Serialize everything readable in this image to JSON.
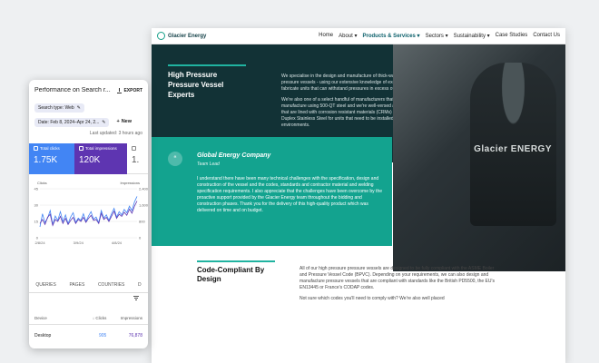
{
  "website": {
    "brand": "Glacier Energy",
    "nav": [
      {
        "label": "Home"
      },
      {
        "label": "About ▾"
      },
      {
        "label": "Products & Services ▾",
        "active": true
      },
      {
        "label": "Sectors ▾"
      },
      {
        "label": "Sustainability ▾"
      },
      {
        "label": "Case Studies"
      },
      {
        "label": "Contact Us"
      }
    ],
    "hero_title": "High Pressure Pressure Vessel Experts",
    "hero_p1": "We specialise in the design and manufacture of thick-walled high pressure pressure vessels - using our extensive knowledge of exotic materials to fabricate units that can withstand pressures in excess of 460 barg.",
    "hero_p2": "We're also one of a select handful of manufacturers that know how to manufacture using 500-QT steel and we're well-versed at building vessels that are lined with corrosion resistant materials (CRMs) like Austenitic or Duplex Stainless Steel for units that need to be installed in inhospitable environments.",
    "photo_brand": "Glacier ENERGY",
    "testimonial": {
      "name": "Global Energy Company",
      "role": "Team Lead",
      "text": "I understand there have been many technical challenges with the specification, design and construction of the vessel and the codes, standards and contractor material and welding specification requirements. I also appreciate that the challenges have been overcome by the proactive support provided by the Glacier Energy team throughout the bidding and construction phases. Thank you for the delivery of this high-quality product which was delivered on time and on budget."
    },
    "code_title": "Code-Compliant By Design",
    "code_p1": "All of our high pressure pressure vessels are designed to be fully compliant with the ASME Boiler and Pressure Vessel Code (BPVC). Depending on your requirements, we can also design and manufacture pressure vessels that are compliant with standards like the British PD5500, the EU's EN13445 or France's CODAP codes.",
    "code_p2": "Not sure which codes you'll need to comply with? We're also well placed"
  },
  "gsc": {
    "title": "Performance on Search r...",
    "export": "EXPORT",
    "search_type": "Search type: Web",
    "date_range": "Date: Feb 8, 2024–Apr 24, 2...",
    "new": "New",
    "updated": "Last updated: 3 hours ago",
    "metrics": {
      "clicks_label": "Total clicks",
      "clicks_value": "1.75K",
      "impr_label": "Total impressions",
      "impr_value": "120K",
      "third_label": "",
      "third_value": "1."
    },
    "tabs": [
      "QUERIES",
      "PAGES",
      "COUNTRIES",
      "D"
    ],
    "table": {
      "headers": [
        "Device",
        "Clicks",
        "Impressions"
      ],
      "rows": [
        {
          "device": "Desktop",
          "clicks": "905",
          "impressions": "76,878"
        }
      ]
    }
  },
  "chart_data": {
    "type": "line",
    "title": "",
    "xlabel": "",
    "ylabel": "Clicks",
    "y2label": "Impressions",
    "x": [
      "2/8/24",
      "2/10",
      "2/12",
      "2/14",
      "2/16",
      "2/18",
      "2/20",
      "2/22",
      "2/24",
      "2/26",
      "2/28",
      "3/1",
      "3/3",
      "3/5",
      "3/7",
      "3/9",
      "3/11",
      "3/13",
      "3/15",
      "3/17",
      "3/19",
      "3/21",
      "3/23",
      "3/25",
      "3/27",
      "3/29",
      "3/31",
      "4/2",
      "4/4",
      "4/6",
      "4/8",
      "4/10",
      "4/12",
      "4/14",
      "4/16",
      "4/18",
      "4/20",
      "4/22",
      "4/24"
    ],
    "x_tick_labels": [
      "2/8/24",
      "3/9/24",
      "4/8/24"
    ],
    "ylim": [
      0,
      45
    ],
    "y_ticks": [
      0,
      15,
      30,
      45
    ],
    "y2lim": [
      0,
      2400
    ],
    "y2_ticks": [
      0,
      800,
      1600,
      2400
    ],
    "series": [
      {
        "name": "Clicks",
        "color": "#4285f4",
        "axis": "left",
        "values": [
          10,
          22,
          14,
          18,
          25,
          12,
          20,
          16,
          24,
          15,
          21,
          13,
          19,
          23,
          14,
          18,
          16,
          22,
          15,
          20,
          24,
          17,
          19,
          14,
          25,
          18,
          21,
          16,
          22,
          27,
          19,
          24,
          21,
          26,
          23,
          29,
          25,
          33,
          38
        ]
      },
      {
        "name": "Impressions",
        "color": "#5e35b1",
        "axis": "right",
        "values": [
          700,
          900,
          650,
          1000,
          1150,
          600,
          900,
          800,
          1050,
          700,
          950,
          650,
          850,
          1000,
          700,
          900,
          800,
          1000,
          750,
          950,
          1100,
          850,
          900,
          700,
          1200,
          900,
          1000,
          800,
          1050,
          1300,
          950,
          1150,
          1050,
          1250,
          1100,
          1400,
          1200,
          1550,
          1800
        ]
      }
    ]
  }
}
